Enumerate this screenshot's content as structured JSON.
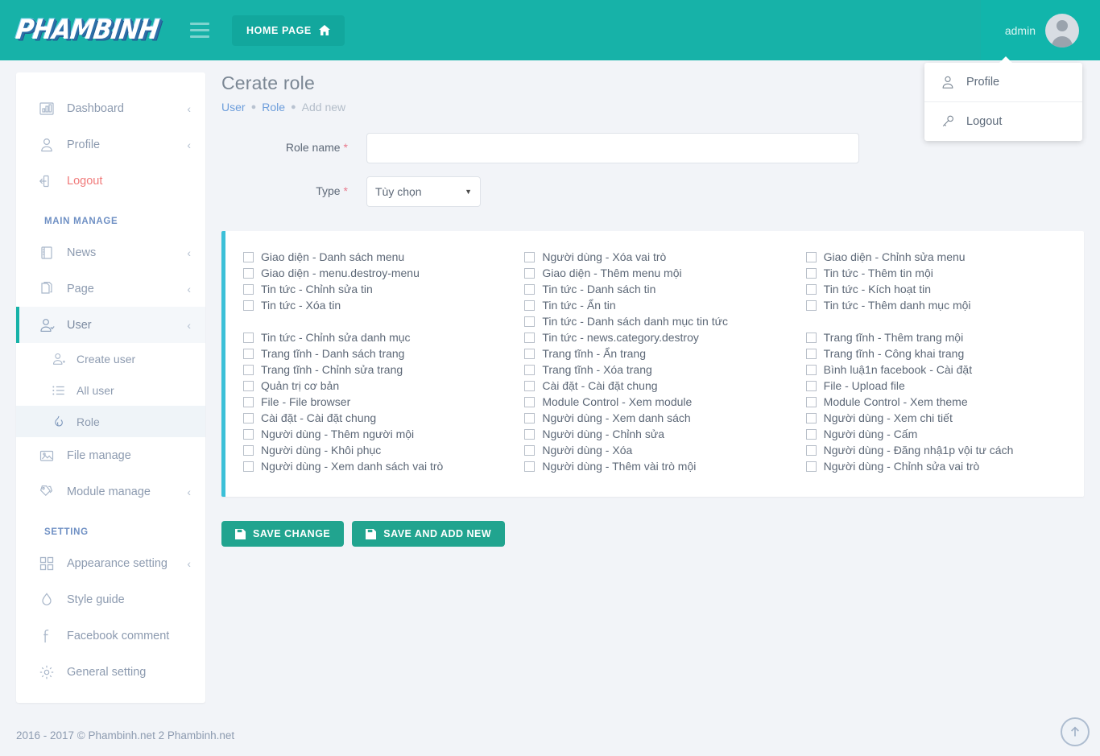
{
  "brand": {
    "logo_text": "PHAMBINH"
  },
  "colors": {
    "primary": "#17b2a8",
    "accent": "#3cc0d8",
    "button": "#21a48f",
    "danger": "#f07a7a",
    "link": "#6c9ddb"
  },
  "topbar": {
    "hamburger_icon": "hamburger-icon",
    "home_page_label": "HOME PAGE",
    "home_icon": "home-icon",
    "admin_name": "admin",
    "avatar_icon": "user-avatar-icon"
  },
  "user_dropdown": {
    "items": [
      {
        "label": "Profile",
        "icon": "user-outline-icon"
      },
      {
        "label": "Logout",
        "icon": "key-icon"
      }
    ]
  },
  "sidebar": {
    "items": [
      {
        "label": "Dashboard",
        "icon": "bar-chart-icon",
        "chevron": "‹",
        "state": ""
      },
      {
        "label": "Profile",
        "icon": "user-outline-icon",
        "chevron": "‹",
        "state": ""
      },
      {
        "label": "Logout",
        "icon": "logout-icon",
        "chevron": "",
        "state": "red"
      }
    ],
    "section_main_label": "MAIN MANAGE",
    "main_items": [
      {
        "label": "News",
        "icon": "book-icon",
        "chevron": "‹",
        "state": ""
      },
      {
        "label": "Page",
        "icon": "pages-icon",
        "chevron": "‹",
        "state": ""
      },
      {
        "label": "User",
        "icon": "user-manage-icon",
        "chevron": "‹",
        "state": "active"
      }
    ],
    "user_subitems": [
      {
        "label": "Create user",
        "icon": "user-add-icon",
        "state": ""
      },
      {
        "label": "All user",
        "icon": "list-icon",
        "state": ""
      },
      {
        "label": "Role",
        "icon": "flame-icon",
        "state": "active"
      }
    ],
    "main_items_after": [
      {
        "label": "File manage",
        "icon": "image-icon",
        "chevron": "",
        "state": ""
      },
      {
        "label": "Module manage",
        "icon": "tags-icon",
        "chevron": "‹",
        "state": ""
      }
    ],
    "section_setting_label": "SETTING",
    "setting_items": [
      {
        "label": "Appearance setting",
        "icon": "grid-icon",
        "chevron": "‹",
        "state": ""
      },
      {
        "label": "Style guide",
        "icon": "droplet-icon",
        "chevron": "",
        "state": ""
      },
      {
        "label": "Facebook comment",
        "icon": "facebook-icon",
        "chevron": "",
        "state": ""
      },
      {
        "label": "General setting",
        "icon": "gear-icon",
        "chevron": "",
        "state": ""
      }
    ]
  },
  "main": {
    "page_title": "Cerate role",
    "breadcrumb": [
      {
        "label": "User",
        "type": "link"
      },
      {
        "label": "Role",
        "type": "link"
      },
      {
        "label": "Add new",
        "type": "current"
      }
    ],
    "form": {
      "role_name_label": "Role name",
      "role_name_value": "",
      "role_name_placeholder": "",
      "type_label": "Type",
      "type_value": "Tùy chọn",
      "required_marker": "*",
      "caret_icon": "caret-down-icon"
    },
    "permissions": [
      {
        "label": "Giao diện - Danh sách menu",
        "checked": false
      },
      {
        "label": "Giao diện - menu.destroy-menu",
        "checked": false
      },
      {
        "label": "Tin tức - Chỉnh sửa tin",
        "checked": false
      },
      {
        "label": "Tin tức - Xóa tin",
        "checked": false
      },
      {
        "label": "__GAP__",
        "checked": false
      },
      {
        "label": "Tin tức - Chỉnh sửa danh mục",
        "checked": false
      },
      {
        "label": "Trang tĩnh - Danh sách trang",
        "checked": false
      },
      {
        "label": "Trang tĩnh - Chỉnh sửa trang",
        "checked": false
      },
      {
        "label": "Quản trị cơ bản",
        "checked": false
      },
      {
        "label": "File - File browser",
        "checked": false
      },
      {
        "label": "Cài đặt - Cài đặt chung",
        "checked": false
      },
      {
        "label": "Người dùng - Thêm người mội",
        "checked": false
      },
      {
        "label": "Người dùng - Khôi phục",
        "checked": false
      },
      {
        "label": "Người dùng - Xem danh sách vai trò",
        "checked": false
      },
      {
        "label": "Người dùng - Xóa vai trò",
        "checked": false
      },
      {
        "label": "Giao diện - Thêm menu mội",
        "checked": false
      },
      {
        "label": "Tin tức - Danh sách tin",
        "checked": false
      },
      {
        "label": "Tin tức - Ẩn tin",
        "checked": false
      },
      {
        "label": "Tin tức - Danh sách danh mục tin tức",
        "checked": false
      },
      {
        "label": "Tin tức - news.category.destroy",
        "checked": false
      },
      {
        "label": "Trang tĩnh - Ẩn trang",
        "checked": false
      },
      {
        "label": "Trang tĩnh - Xóa trang",
        "checked": false
      },
      {
        "label": "Cài đặt - Cài đặt chung",
        "checked": false
      },
      {
        "label": "Module Control - Xem module",
        "checked": false
      },
      {
        "label": "Người dùng - Xem danh sách",
        "checked": false
      },
      {
        "label": "Người dùng - Chỉnh sửa",
        "checked": false
      },
      {
        "label": "Người dùng - Xóa",
        "checked": false
      },
      {
        "label": "Người dùng - Thêm vài trò mội",
        "checked": false
      },
      {
        "label": "Giao diện - Chỉnh sửa menu",
        "checked": false
      },
      {
        "label": "Tin tức - Thêm tin mội",
        "checked": false
      },
      {
        "label": "Tin tức - Kích hoạt tin",
        "checked": false
      },
      {
        "label": "Tin tức - Thêm danh mục mội",
        "checked": false
      },
      {
        "label": "__GAP__",
        "checked": false
      },
      {
        "label": "Trang tĩnh - Thêm trang mội",
        "checked": false
      },
      {
        "label": "Trang tĩnh - Công khai trang",
        "checked": false
      },
      {
        "label": "Bình luậ1n facebook - Cài đặt",
        "checked": false
      },
      {
        "label": "File - Upload file",
        "checked": false
      },
      {
        "label": "Module Control - Xem theme",
        "checked": false
      },
      {
        "label": "Người dùng - Xem chi tiết",
        "checked": false
      },
      {
        "label": "Người dùng - Cấm",
        "checked": false
      },
      {
        "label": "Người dùng - Đăng nhậ1p vội tư cách",
        "checked": false
      },
      {
        "label": "Người dùng - Chỉnh sửa vai trò",
        "checked": false
      }
    ],
    "buttons": [
      {
        "label": "SAVE CHANGE",
        "icon": "save-icon"
      },
      {
        "label": "SAVE AND ADD NEW",
        "icon": "save-icon"
      }
    ]
  },
  "footer": {
    "copyright": "2016 - 2017 © Phambinh.net 2 Phambinh.net",
    "totop_icon": "arrow-up-circle-icon"
  }
}
